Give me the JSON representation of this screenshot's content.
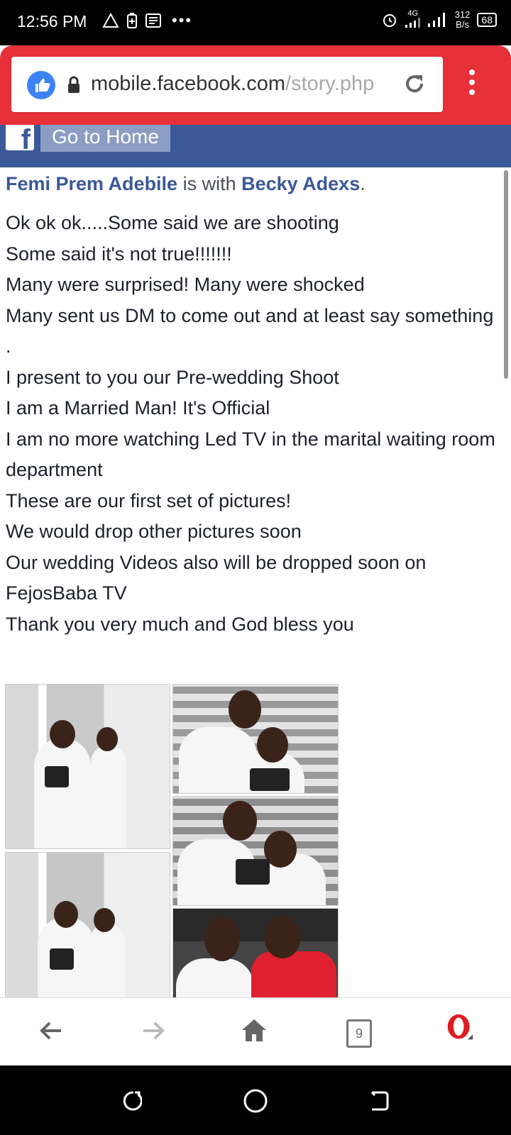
{
  "status": {
    "time": "12:56 PM",
    "network_speed_value": "312",
    "network_speed_unit": "B/s",
    "network_type": "4G",
    "battery": "68"
  },
  "browser": {
    "url_domain": "mobile.facebook.com",
    "url_path": "/story.php",
    "tabs_count": "9"
  },
  "fb": {
    "home_button": "Go to Home"
  },
  "post": {
    "author": "Femi Prem Adebile",
    "with_text": " is with ",
    "tagged": "Becky Adexs",
    "end_punct": ".",
    "body": "Ok ok ok.....Some  said we are shooting\nSome said it's not true!!!!!!!\nMany were surprised! Many were shocked\nMany sent us DM to come out and at least say something\n.\nI present to you our Pre-wedding Shoot\nI am a Married Man! It's Official\nI am no more watching Led TV in the marital waiting room department\nThese are our first set of pictures!\nWe would drop other pictures soon\nOur wedding Videos also will be dropped soon on FejosBaba TV\nThank you very much and God bless you"
  },
  "colors": {
    "browser_red": "#e8303a",
    "fb_blue": "#3b5998",
    "link_blue": "#3b5998"
  },
  "icons": [
    "warning-icon",
    "battery-saver-icon",
    "news-icon",
    "alarm-icon",
    "signal-icon",
    "like-icon",
    "lock-icon",
    "reload-icon",
    "menu-icon",
    "back-icon",
    "forward-icon",
    "home-icon",
    "tabs-icon",
    "opera-icon",
    "recents-icon",
    "android-home-icon",
    "android-back-icon"
  ]
}
